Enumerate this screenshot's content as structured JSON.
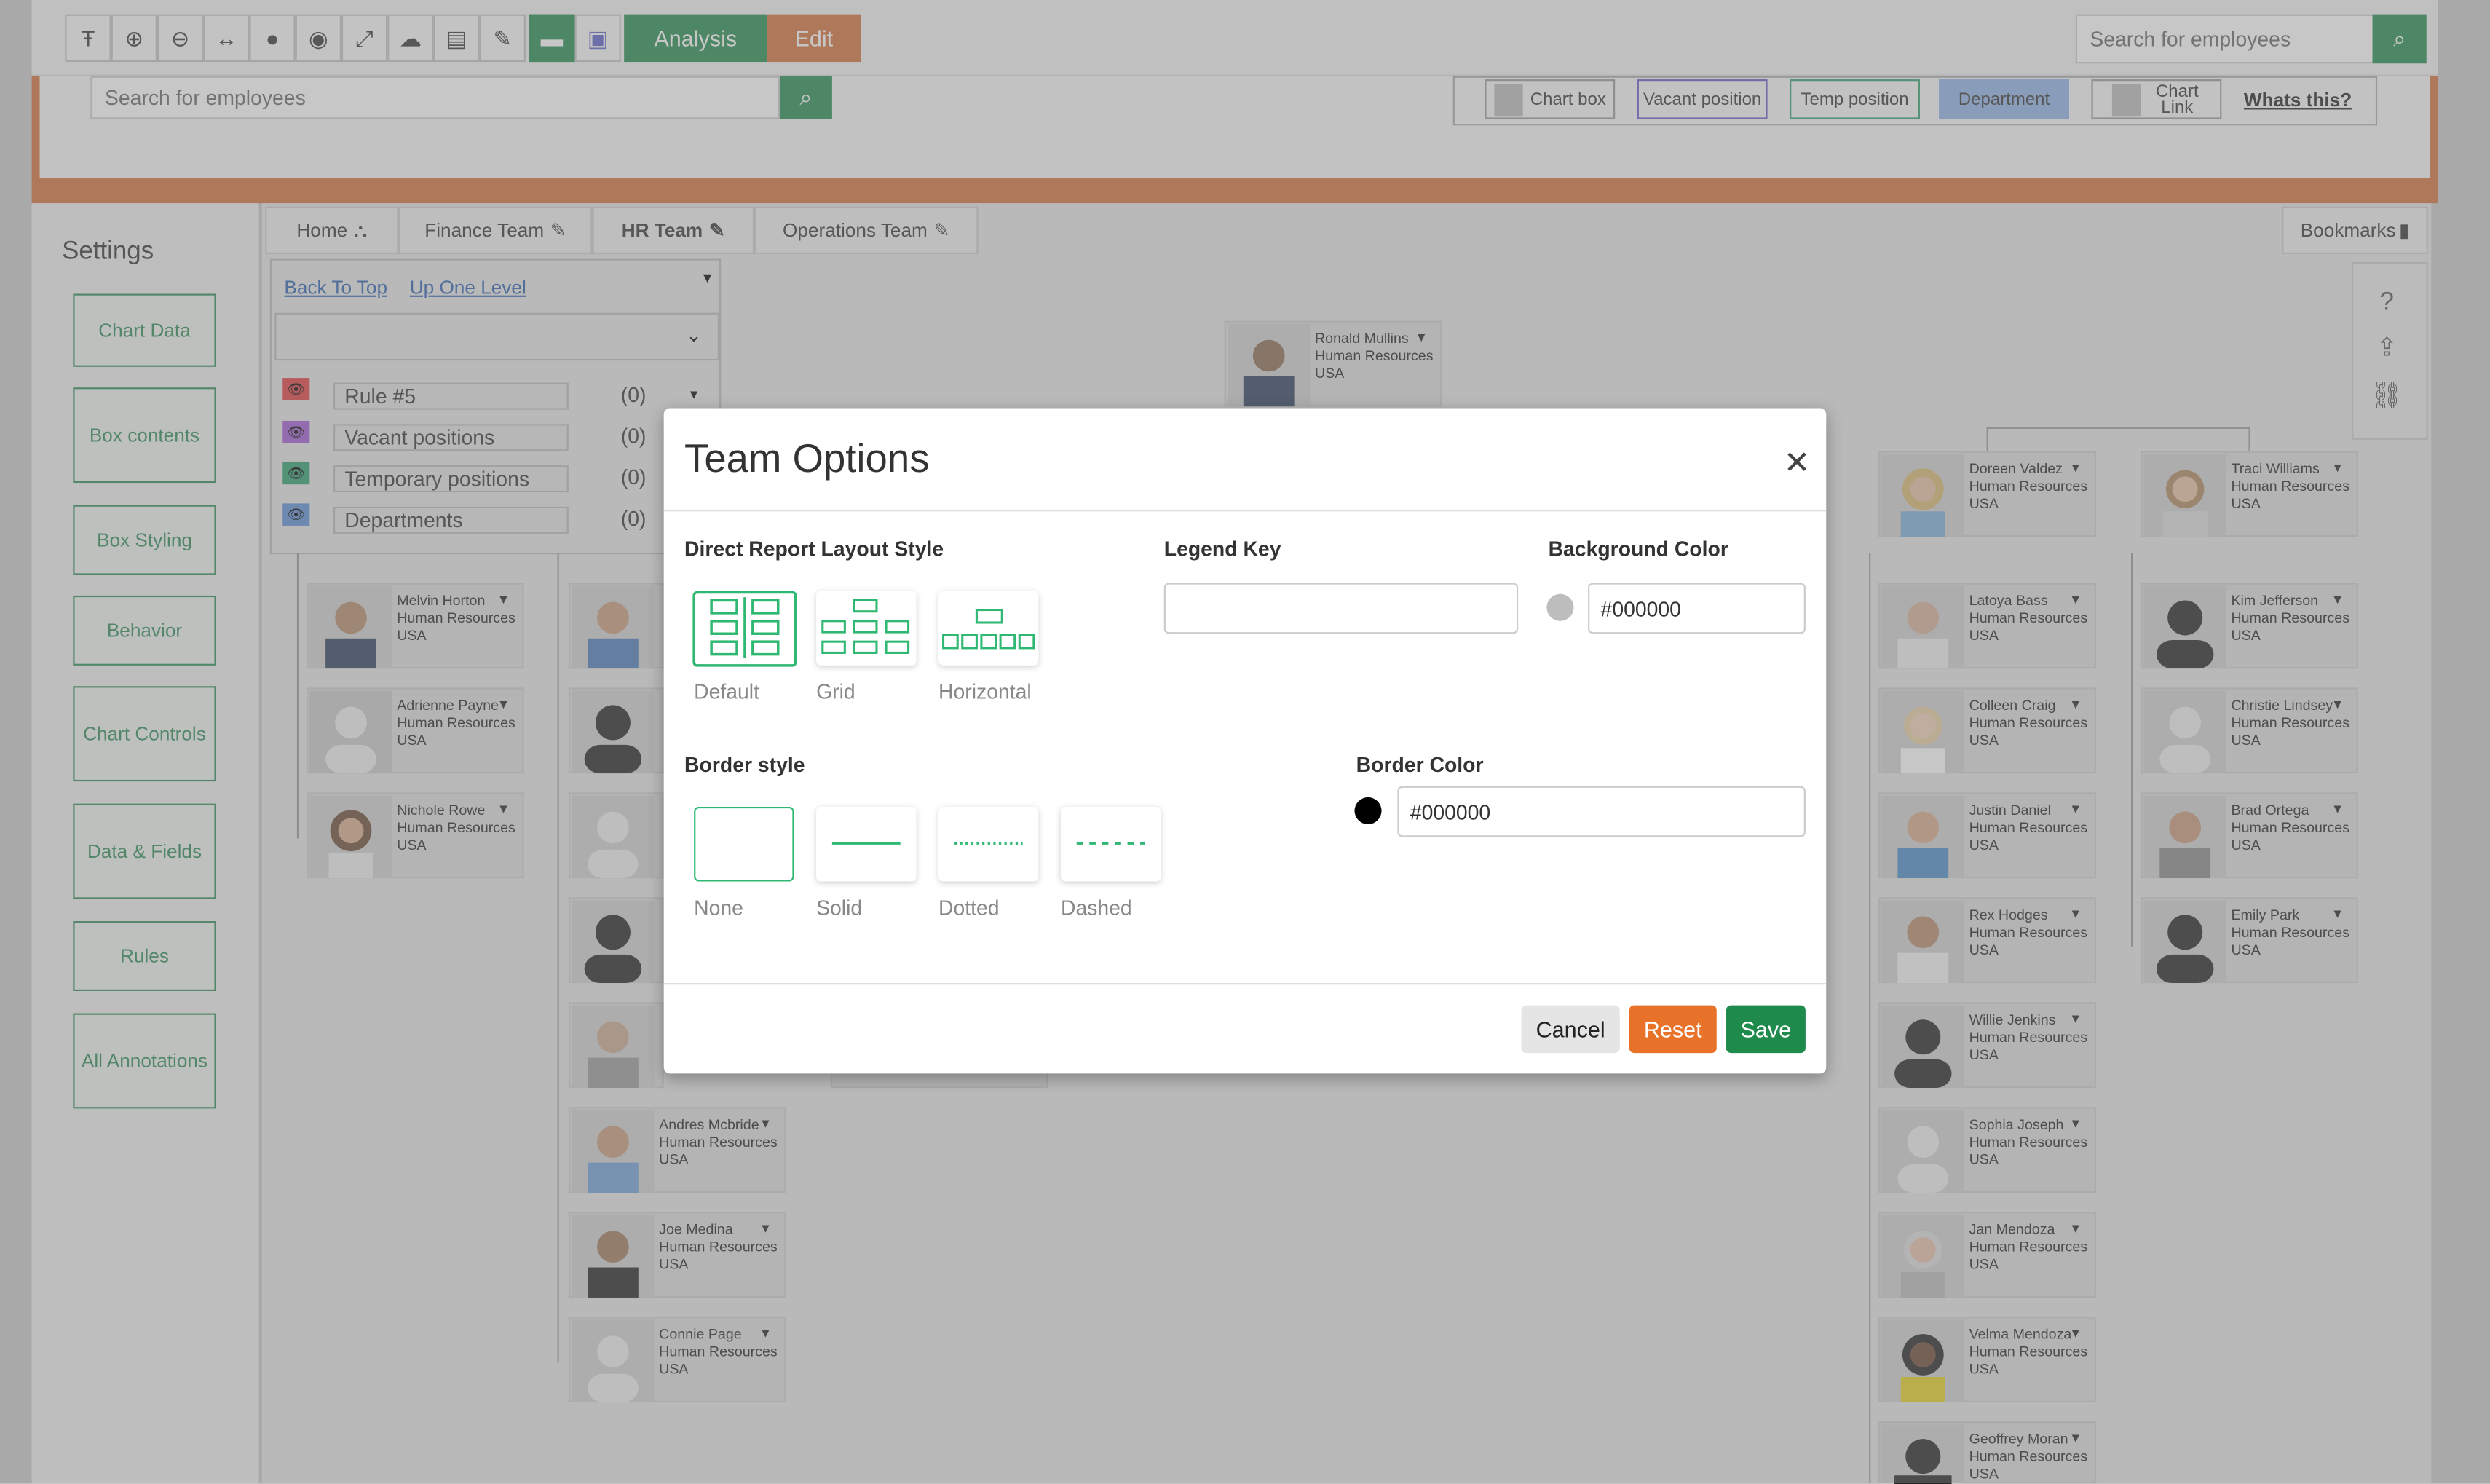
{
  "toolbar": {
    "analysis_label": "Analysis",
    "edit_label": "Edit",
    "search_placeholder": "Search for employees",
    "icons": [
      "text-format-icon",
      "zoom-in-icon",
      "zoom-out-icon",
      "fit-width-icon",
      "plus-circle-icon",
      "minus-circle-icon",
      "expand-icon",
      "cloud-upload-icon",
      "excel-export-icon",
      "paint-brush-icon",
      "comment-icon",
      "teams-icon"
    ]
  },
  "sub_search": {
    "placeholder": "Search for employees"
  },
  "legend": {
    "chart_box": "Chart box",
    "vacant_position": "Vacant position",
    "temp_position": "Temp position",
    "department": "Department",
    "chart_link": "Chart Link",
    "whats_this": "Whats this?"
  },
  "sidebar": {
    "title": "Settings",
    "items": [
      "Chart Data",
      "Box contents",
      "Box Styling",
      "Behavior",
      "Chart Controls",
      "Data & Fields",
      "Rules",
      "All Annotations"
    ]
  },
  "tabs": [
    {
      "label": "Home"
    },
    {
      "label": "Finance Team"
    },
    {
      "label": "HR Team"
    },
    {
      "label": "Operations Team"
    }
  ],
  "bookmarks_label": "Bookmarks",
  "nav": {
    "back_to_top": "Back To Top",
    "up_one_level": "Up One Level"
  },
  "rules": [
    {
      "label": "Rule #5",
      "count": "(0)",
      "color": "#e03c3c"
    },
    {
      "label": "Vacant positions",
      "count": "(0)",
      "color": "#a15ad6"
    },
    {
      "label": "Temporary positions",
      "count": "(0)",
      "color": "#2e9e6d"
    },
    {
      "label": "Departments",
      "count": "(0)",
      "color": "#5b8fd6"
    }
  ],
  "chart": {
    "root": {
      "name": "Ronald Mullins",
      "dept": "Human Resources",
      "country": "USA"
    },
    "col1": [
      {
        "name": "Melvin Horton",
        "dept": "Human Resources",
        "country": "USA"
      },
      {
        "name": "Adrienne Payne",
        "dept": "Human Resources",
        "country": "USA"
      },
      {
        "name": "Nichole Rowe",
        "dept": "Human Resources",
        "country": "USA"
      }
    ],
    "col2": [
      {
        "name": "Andres Mcbride",
        "dept": "Human Resources",
        "country": "USA"
      },
      {
        "name": "Joe Medina",
        "dept": "Human Resources",
        "country": "USA"
      },
      {
        "name": "Connie Page",
        "dept": "Human Resources",
        "country": "USA"
      }
    ],
    "col3_head": {
      "name": "Doreen Valdez",
      "dept": "Human Resources",
      "country": "USA"
    },
    "col3": [
      {
        "name": "Latoya Bass",
        "dept": "Human Resources",
        "country": "USA"
      },
      {
        "name": "Colleen Craig",
        "dept": "Human Resources",
        "country": "USA"
      },
      {
        "name": "Justin Daniel",
        "dept": "Human Resources",
        "country": "USA"
      },
      {
        "name": "Rex Hodges",
        "dept": "Human Resources",
        "country": "USA"
      },
      {
        "name": "Willie Jenkins",
        "dept": "Human Resources",
        "country": "USA"
      },
      {
        "name": "Sophia Joseph",
        "dept": "Human Resources",
        "country": "USA"
      },
      {
        "name": "Jan Mendoza",
        "dept": "Human Resources",
        "country": "USA"
      },
      {
        "name": "Velma Mendoza",
        "dept": "Human Resources",
        "country": "USA"
      },
      {
        "name": "Geoffrey Moran",
        "dept": "Human Resources",
        "country": "USA"
      }
    ],
    "col4_head": {
      "name": "Traci Williams",
      "dept": "Human Resources",
      "country": "USA"
    },
    "col4": [
      {
        "name": "Kim Jefferson",
        "dept": "Human Resources",
        "country": "USA"
      },
      {
        "name": "Christie Lindsey",
        "dept": "Human Resources",
        "country": "USA"
      },
      {
        "name": "Brad Ortega",
        "dept": "Human Resources",
        "country": "USA"
      },
      {
        "name": "Emily Park",
        "dept": "Human Resources",
        "country": "USA"
      }
    ]
  },
  "modal": {
    "title": "Team Options",
    "layout_label": "Direct Report Layout Style",
    "layout_options": [
      "Default",
      "Grid",
      "Horizontal"
    ],
    "legend_key_label": "Legend Key",
    "legend_key_value": "",
    "bg_color_label": "Background Color",
    "bg_color_value": "#000000",
    "border_style_label": "Border style",
    "border_options": [
      "None",
      "Solid",
      "Dotted",
      "Dashed"
    ],
    "border_color_label": "Border Color",
    "border_color_value": "#000000",
    "cancel_label": "Cancel",
    "reset_label": "Reset",
    "save_label": "Save",
    "accent_color": "#2eb872",
    "save_color": "#1e8a4c",
    "reset_color": "#e8722a"
  }
}
